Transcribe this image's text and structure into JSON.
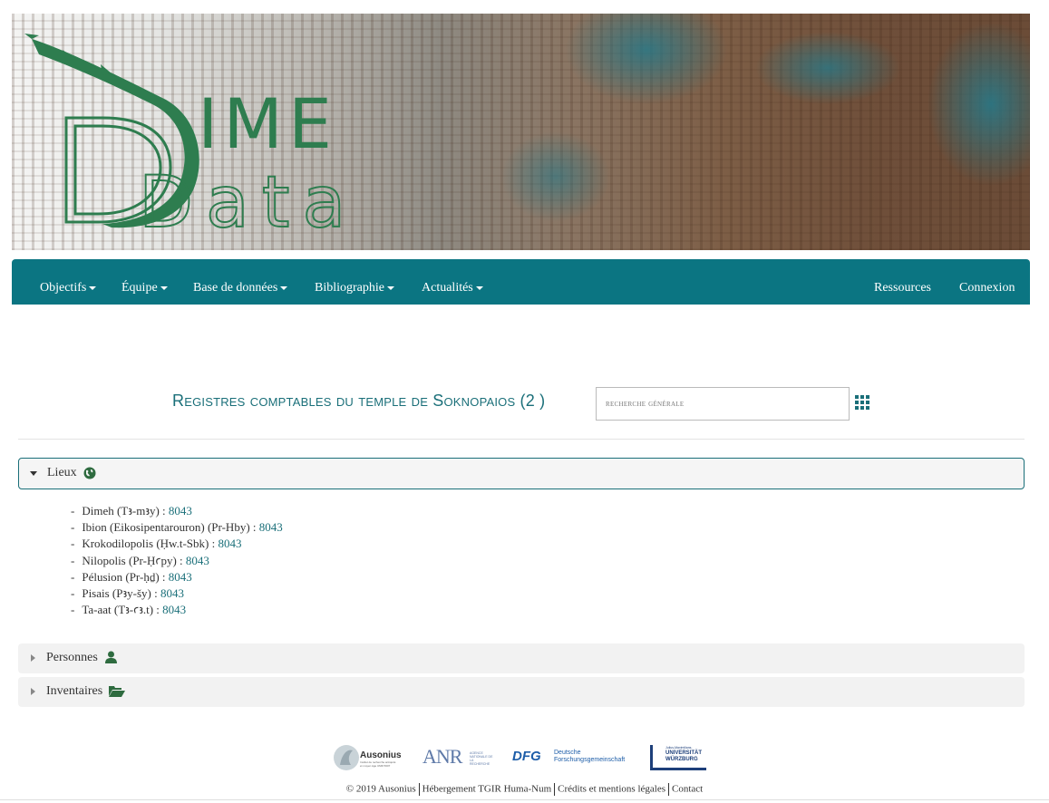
{
  "header": {
    "logo_text_top": "IME",
    "logo_text_bottom": "Data",
    "logo_letter": "D",
    "brand_color": "#2e7d4f",
    "banner_icon": "crocodile-logo"
  },
  "navbar": {
    "color": "#0b7582",
    "left_items": [
      {
        "label": "Objectifs"
      },
      {
        "label": "Équipe"
      },
      {
        "label": "Base de données"
      },
      {
        "label": "Bibliographie"
      },
      {
        "label": "Actualités"
      }
    ],
    "right_items": [
      {
        "label": "Ressources"
      },
      {
        "label": "Connexion"
      }
    ]
  },
  "main": {
    "title": "Registres comptables du temple de Soknopaios (2 )",
    "search_placeholder": "recherche générale",
    "grid_icon": "th-grid-icon"
  },
  "sections": [
    {
      "title": "Lieux",
      "icon": "globe-icon",
      "expanded": true
    },
    {
      "title": "Personnes",
      "icon": "user-icon",
      "expanded": false
    },
    {
      "title": "Inventaires",
      "icon": "folder-open-icon",
      "expanded": false
    }
  ],
  "places": [
    {
      "name": "Dimeh (Tꜣ-mꜣy) :",
      "link": "8043"
    },
    {
      "name": "Ibion (Eikosipentarouron) (Pr-Hby) :",
      "link": "8043"
    },
    {
      "name": "Krokodilopolis (Ḥw.t-Sbk) :",
      "link": "8043"
    },
    {
      "name": "Nilopolis (Pr-Ḥꜥpy) :",
      "link": "8043"
    },
    {
      "name": "Pélusion (Pr-ḥḏ) :",
      "link": "8043"
    },
    {
      "name": "Pisais (Pꜣy-šy) :",
      "link": "8043"
    },
    {
      "name": "Ta-aat (Tꜣ-ꜥꜣ.t) :",
      "link": "8043"
    }
  ],
  "footer": {
    "logos": [
      {
        "name": "Ausonius",
        "sub": "Institut de recherche antiquité et moyen âge UMR 5607"
      },
      {
        "name": "ANR",
        "sub": "AGENCE NATIONALE DE LA RECHERCHE"
      },
      {
        "name": "DFG",
        "sub": "Deutsche Forschungsgemeinschaft"
      },
      {
        "name": "UNIVERSITÄT WÜRZBURG",
        "sub": "Julius-Maximilians-"
      }
    ],
    "links": [
      {
        "label": "© 2019 Ausonius"
      },
      {
        "label": "Hébergement TGIR Huma-Num"
      },
      {
        "label": "Crédits et mentions légales"
      },
      {
        "label": "Contact"
      }
    ]
  }
}
